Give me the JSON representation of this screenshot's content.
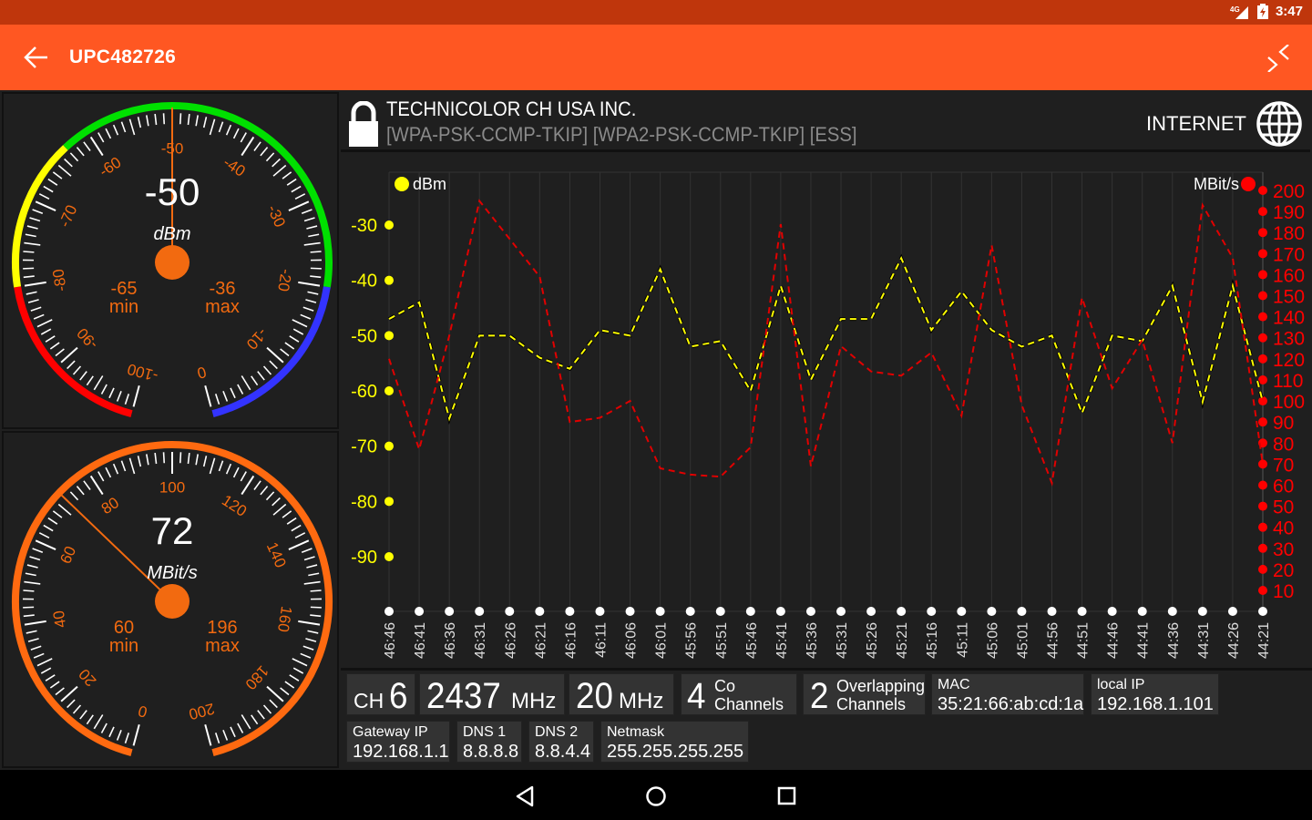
{
  "status_bar": {
    "network_type": "4G",
    "time": "3:47",
    "icons": [
      "signal-icon",
      "battery-charging-icon"
    ]
  },
  "app_bar": {
    "title": "UPC482726",
    "back_icon": "arrow-left-icon",
    "collapse_icon": "collapse-icon"
  },
  "signal_gauge": {
    "value": "-50",
    "unit": "dBm",
    "min_value": "-65",
    "min_label": "min",
    "max_value": "-36",
    "max_label": "max",
    "needle_value": -50,
    "range": [
      -100,
      0
    ],
    "tick_labels": [
      "-100",
      "-90",
      "-80",
      "-70",
      "-60",
      "-50",
      "-40",
      "-30",
      "-20",
      "-10",
      "0"
    ],
    "zones": [
      {
        "from": -100,
        "to": -80,
        "color": "#FF0000"
      },
      {
        "from": -80,
        "to": -63,
        "color": "#FFFF00"
      },
      {
        "from": -63,
        "to": -20,
        "color": "#00E000"
      },
      {
        "from": -20,
        "to": 0,
        "color": "#3333FF"
      }
    ]
  },
  "speed_gauge": {
    "value": "72",
    "unit": "MBit/s",
    "min_value": "60",
    "min_label": "min",
    "max_value": "196",
    "max_label": "max",
    "needle_value": 72,
    "range": [
      0,
      200
    ],
    "tick_labels": [
      "0",
      "20",
      "40",
      "60",
      "80",
      "100",
      "120",
      "140",
      "160",
      "180",
      "200"
    ],
    "arc_color": "#FF6A10"
  },
  "network": {
    "vendor": "TECHNICOLOR CH USA INC.",
    "capabilities": "[WPA-PSK-CCMP-TKIP]  [WPA2-PSK-CCMP-TKIP]  [ESS]",
    "internet_label": "INTERNET",
    "lock_icon": "lock-icon",
    "globe_icon": "globe-icon"
  },
  "info": {
    "channel_prefix": "CH",
    "channel": "6",
    "frequency": "2437",
    "frequency_unit": "MHz",
    "width": "20",
    "width_unit": "MHz",
    "co_channels_count": "4",
    "co_channels_line1": "Co",
    "co_channels_line2": "Channels",
    "overlapping_count": "2",
    "overlapping_line1": "Overlapping",
    "overlapping_line2": "Channels",
    "mac_label": "MAC",
    "mac": "35:21:66:ab:cd:1a",
    "local_ip_label": "local IP",
    "local_ip": "192.168.1.101",
    "gateway_label": "Gateway IP",
    "gateway": "192.168.1.1",
    "dns1_label": "DNS 1",
    "dns1": "8.8.8.8",
    "dns2_label": "DNS 2",
    "dns2": "8.8.4.4",
    "netmask_label": "Netmask",
    "netmask": "255.255.255.255"
  },
  "nav_bar": {
    "back_icon": "nav-back-icon",
    "home_icon": "nav-home-icon",
    "recents_icon": "nav-recents-icon"
  },
  "chart_data": {
    "type": "line",
    "title": "",
    "x": [
      "46:46",
      "46:41",
      "46:36",
      "46:31",
      "46:26",
      "46:21",
      "46:16",
      "46:11",
      "46:06",
      "46:01",
      "45:56",
      "45:51",
      "45:46",
      "45:41",
      "45:36",
      "45:31",
      "45:26",
      "45:21",
      "45:16",
      "45:11",
      "45:06",
      "45:01",
      "44:56",
      "44:51",
      "44:46",
      "44:41",
      "44:36",
      "44:31",
      "44:26",
      "44:21"
    ],
    "left_axis": {
      "label": "dBm",
      "ticks": [
        "-30",
        "-40",
        "-50",
        "-60",
        "-70",
        "-80",
        "-90"
      ],
      "range": [
        -30,
        -90
      ],
      "color": "#FFFF00"
    },
    "right_axis": {
      "label": "MBit/s",
      "ticks": [
        "200",
        "190",
        "180",
        "170",
        "160",
        "150",
        "140",
        "130",
        "120",
        "110",
        "100",
        "90",
        "80",
        "70",
        "60",
        "50",
        "40",
        "30",
        "20",
        "10"
      ],
      "range": [
        10,
        200
      ],
      "color": "#FF0000"
    },
    "grid": true,
    "legend": [
      "dBm (top-left)",
      "MBit/s (top-right)"
    ],
    "series": [
      {
        "name": "dBm",
        "axis": "left",
        "color": "#FFFF00",
        "style": "dashed",
        "values": [
          -47,
          -44,
          -65,
          -50,
          -50,
          -54,
          -56,
          -49,
          -50,
          -38,
          -52,
          -51,
          -60,
          -41,
          -58,
          -47,
          -47,
          -36,
          -49,
          -42,
          -49,
          -52,
          -50,
          -64,
          -50,
          -51,
          -41,
          -62,
          -41,
          -62
        ]
      },
      {
        "name": "MBit/s",
        "axis": "right",
        "color": "#E00000",
        "style": "dashed",
        "values": [
          120,
          77,
          131,
          195,
          177,
          159,
          90,
          92,
          100,
          68,
          65,
          64,
          78,
          184,
          69,
          126,
          114,
          112,
          123,
          93,
          174,
          98,
          61,
          149,
          106,
          129,
          80,
          193,
          168,
          70
        ]
      }
    ]
  }
}
